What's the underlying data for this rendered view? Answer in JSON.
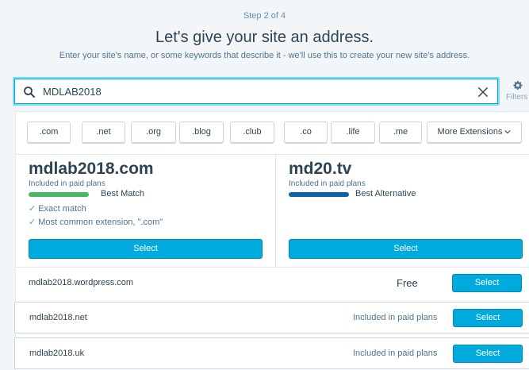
{
  "header": {
    "step": "Step 2 of 4",
    "title": "Let's give your site an address.",
    "subtitle": "Enter your site's name, or some keywords that describe it - we'll use this to create your new site's address."
  },
  "search": {
    "value": "MDLAB2018",
    "filters_label": "Filters"
  },
  "extensions": [
    ".com",
    ".net",
    ".org",
    ".blog",
    ".club",
    ".co",
    ".life",
    ".me"
  ],
  "more_extensions": "More Extensions",
  "suggestions": [
    {
      "domain": "mdlab2018.com",
      "included": "Included in paid plans",
      "badge": "Best Match",
      "badge_color": "#4ab866",
      "checks": [
        "Exact match",
        "Most common extension, \".com\""
      ],
      "select": "Select"
    },
    {
      "domain": "md20.tv",
      "included": "Included in paid plans",
      "badge": "Best Alternative",
      "badge_color": "#0e64a5",
      "checks": [],
      "select": "Select"
    }
  ],
  "rows": [
    {
      "domain": "mdlab2018.wordpress.com",
      "price": "Free",
      "select": "Select"
    },
    {
      "domain": "mdlab2018.net",
      "price": "Included in paid plans",
      "select": "Select"
    },
    {
      "domain": "mdlab2018.uk",
      "price": "Included in paid plans",
      "select": "Select"
    }
  ],
  "colors": {
    "primary": "#00aadc",
    "text": "#2e4453",
    "muted": "#4f748e"
  }
}
